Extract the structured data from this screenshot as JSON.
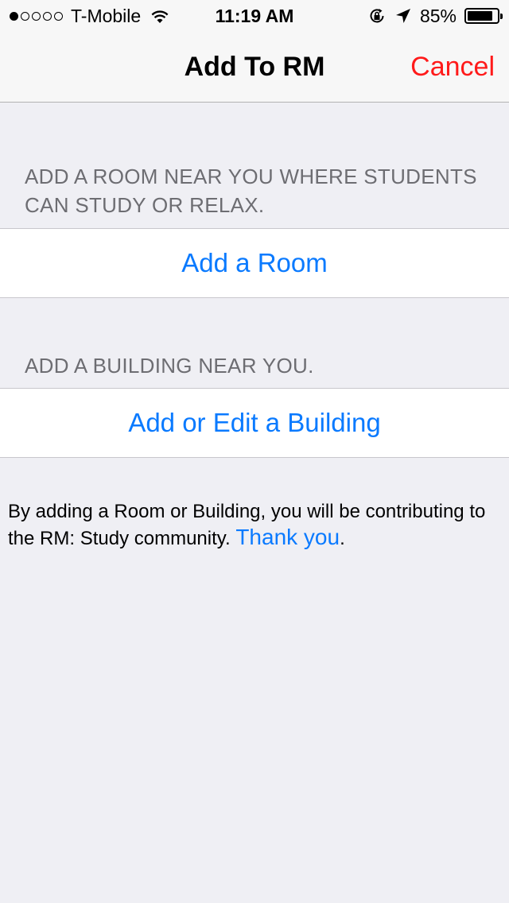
{
  "status_bar": {
    "carrier": "T-Mobile",
    "signal_strength": 1,
    "time": "11:19 AM",
    "battery": "85%",
    "icons": [
      "wifi-icon",
      "orientation-lock-icon",
      "location-arrow-icon",
      "battery-icon"
    ]
  },
  "nav": {
    "title": "Add To RM",
    "cancel_label": "Cancel",
    "cancel_color": "#ff1a1a"
  },
  "sections": {
    "room_header": "ADD A ROOM NEAR YOU WHERE STUDENTS CAN STUDY OR RELAX.",
    "room_button": "Add a Room",
    "building_header": "ADD A BUILDING NEAR YOU.",
    "building_button": "Add or Edit a Building"
  },
  "footer": {
    "text": "By adding a Room or Building, you will be contributing to the RM: Study community.",
    "link": "Thank you",
    "end": "."
  },
  "colors": {
    "accent": "#0a7aff",
    "background": "#efeff4",
    "header_text": "#6d6d72"
  }
}
